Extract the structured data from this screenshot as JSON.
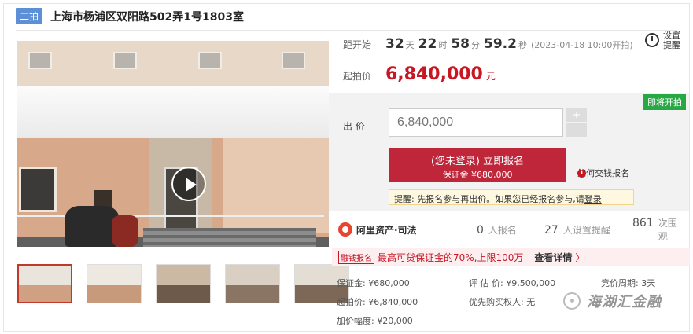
{
  "header": {
    "tag": "二拍",
    "title": "上海市杨浦区双阳路502弄1号1803室"
  },
  "countdown": {
    "label": "距开始",
    "days": "32",
    "days_unit": "天",
    "hours": "22",
    "hours_unit": "时",
    "minutes": "58",
    "minutes_unit": "分",
    "seconds": "59.2",
    "seconds_unit": "秒",
    "start_note": "(2023-04-18 10:00开拍)"
  },
  "start_price": {
    "label": "起拍价",
    "value": "6,840,000",
    "unit": "元"
  },
  "remind": {
    "label": "设置提醒",
    "icon": "alarm-clock-icon"
  },
  "bid": {
    "badge": "即将开拍",
    "label": "出 价",
    "input_value": "6,840,000",
    "plus": "+",
    "minus": "-",
    "signup_main": "(您未登录) 立即报名",
    "signup_sub": "保证金 ¥680,000",
    "help": "如何交钱报名",
    "tip_prefix": "提醒:  先报名参与再出价。如果您已经报名参与,请",
    "tip_login": "登录"
  },
  "stats": {
    "brand": "阿里资产·司法",
    "signups": "0",
    "signups_label": "人报名",
    "reminders": "27",
    "reminders_label": "人设置提醒",
    "views": "861",
    "views_label": "次围观"
  },
  "promo": {
    "chip": "融钱报名",
    "text": "最高可贷保证金的70%,上限100万",
    "more": "查看详情",
    "arrow": "〉"
  },
  "details": {
    "deposit": "保证金:  ¥680,000",
    "start": "起拍价:  ¥6,840,000",
    "increment": "加价幅度:  ¥20,000",
    "valuation": "评 估 价:  ¥9,500,000",
    "priority": "优先购买权人:  无",
    "cycle": "竞价周期:  3天"
  },
  "watermark": {
    "text": "海湖汇金融"
  }
}
